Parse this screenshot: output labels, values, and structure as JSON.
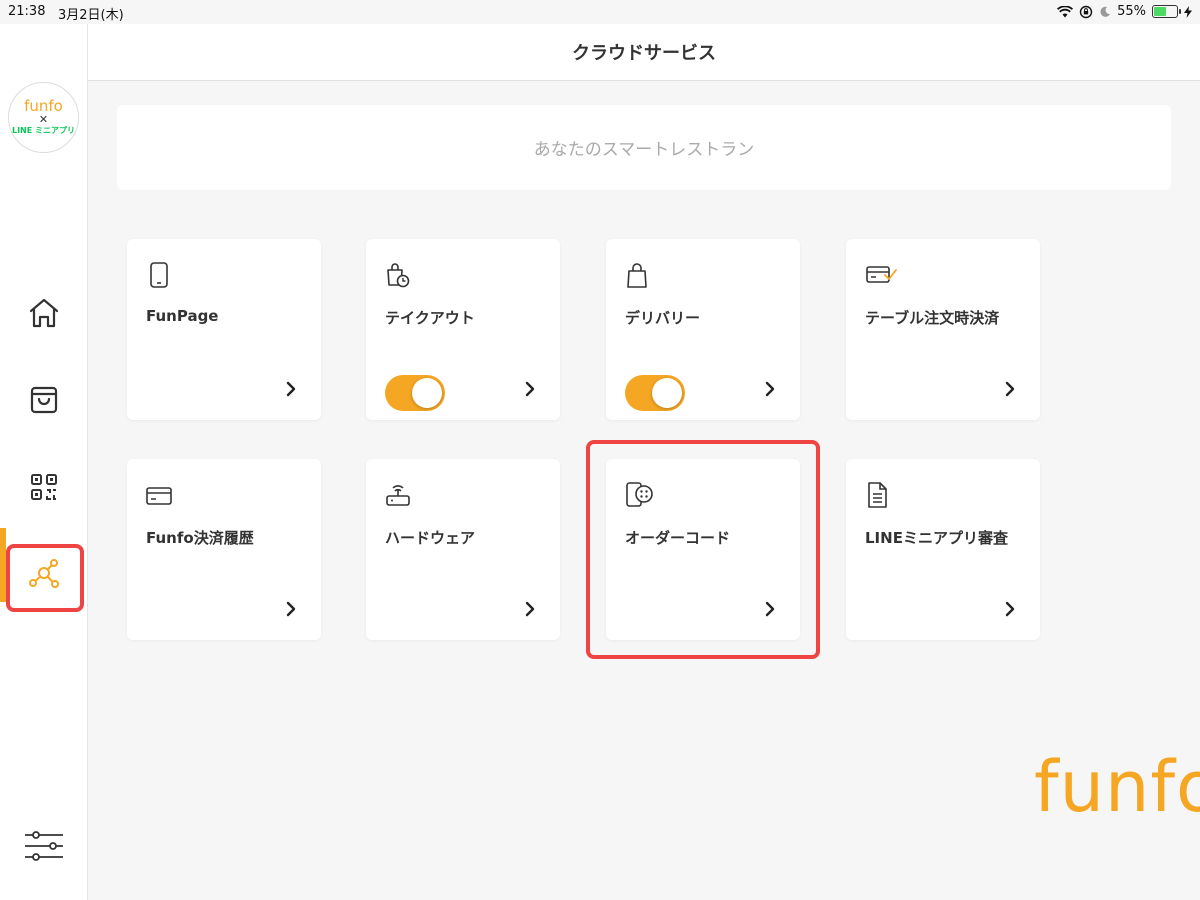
{
  "status_bar": {
    "time": "21:38",
    "date": "3月2日(木)",
    "battery_percent": "55%",
    "battery_level": 0.55
  },
  "sidebar": {
    "logo": {
      "top": "funfo",
      "x": "✕",
      "bottom": "LINE ミニアプリ"
    },
    "items": [
      {
        "name": "home",
        "icon": "home-icon",
        "active": false
      },
      {
        "name": "orders",
        "icon": "shopping-bag-icon",
        "active": false
      },
      {
        "name": "qr-code",
        "icon": "qr-code-icon",
        "active": false
      },
      {
        "name": "cloud-services",
        "icon": "network-nodes-icon",
        "active": true
      },
      {
        "name": "settings",
        "icon": "sliders-icon",
        "active": false
      }
    ]
  },
  "header": {
    "title": "クラウドサービス"
  },
  "tagline": "あなたのスマートレストラン",
  "cards": [
    {
      "label": "FunPage",
      "icon": "phone-icon",
      "toggle": null
    },
    {
      "label": "テイクアウト",
      "icon": "takeout-bag-clock-icon",
      "toggle": true
    },
    {
      "label": "デリバリー",
      "icon": "shopping-bag-icon",
      "toggle": true
    },
    {
      "label": "テーブル注文時決済",
      "icon": "card-check-icon",
      "toggle": null
    },
    {
      "label": "Funfo決済履歴",
      "icon": "credit-card-icon",
      "toggle": null
    },
    {
      "label": "ハードウェア",
      "icon": "router-icon",
      "toggle": null
    },
    {
      "label": "オーダーコード",
      "icon": "order-code-icon",
      "toggle": null,
      "highlighted": true
    },
    {
      "label": "LINEミニアプリ審査",
      "icon": "document-icon",
      "toggle": null
    }
  ],
  "brand": "funfo",
  "colors": {
    "accent": "#f5a623",
    "highlight": "#ef4444",
    "line_green": "#06c755"
  }
}
